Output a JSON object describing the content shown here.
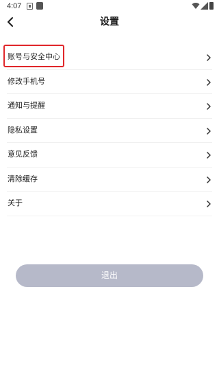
{
  "status_bar": {
    "time": "4:07"
  },
  "header": {
    "title": "设置"
  },
  "menu": {
    "items": [
      {
        "label": "账号与安全中心"
      },
      {
        "label": "修改手机号"
      },
      {
        "label": "通知与提醒"
      },
      {
        "label": "隐私设置"
      },
      {
        "label": "意见反馈"
      },
      {
        "label": "清除缓存"
      },
      {
        "label": "关于"
      }
    ]
  },
  "logout": {
    "label": "退出"
  },
  "colors": {
    "highlight": "#e0262a",
    "logout_bg": "#b6b9c9",
    "text": "#222222"
  },
  "icons": {
    "back": "chevron-left-icon",
    "item_arrow": "chevron-right-icon"
  }
}
